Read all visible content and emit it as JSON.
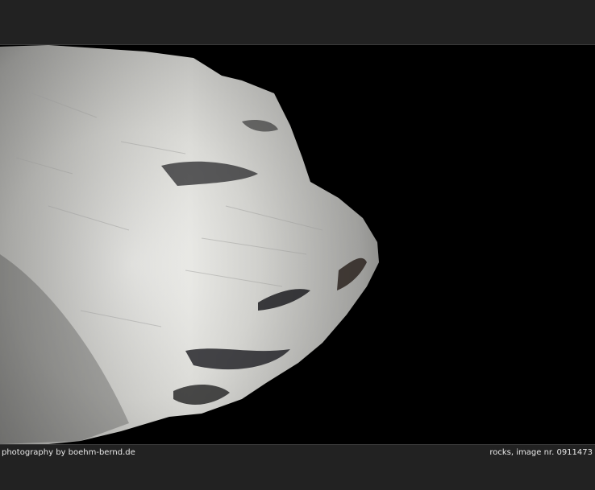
{
  "photo": {
    "subject": "rock-photo",
    "background_color": "#000000",
    "stone_color": "#d9d9d6"
  },
  "captions": {
    "credit": "photography by boehm-bernd.de",
    "title": "rocks, image nr. 0911473"
  },
  "colors": {
    "frame": "#222222",
    "caption_text": "#e8e8e8"
  }
}
